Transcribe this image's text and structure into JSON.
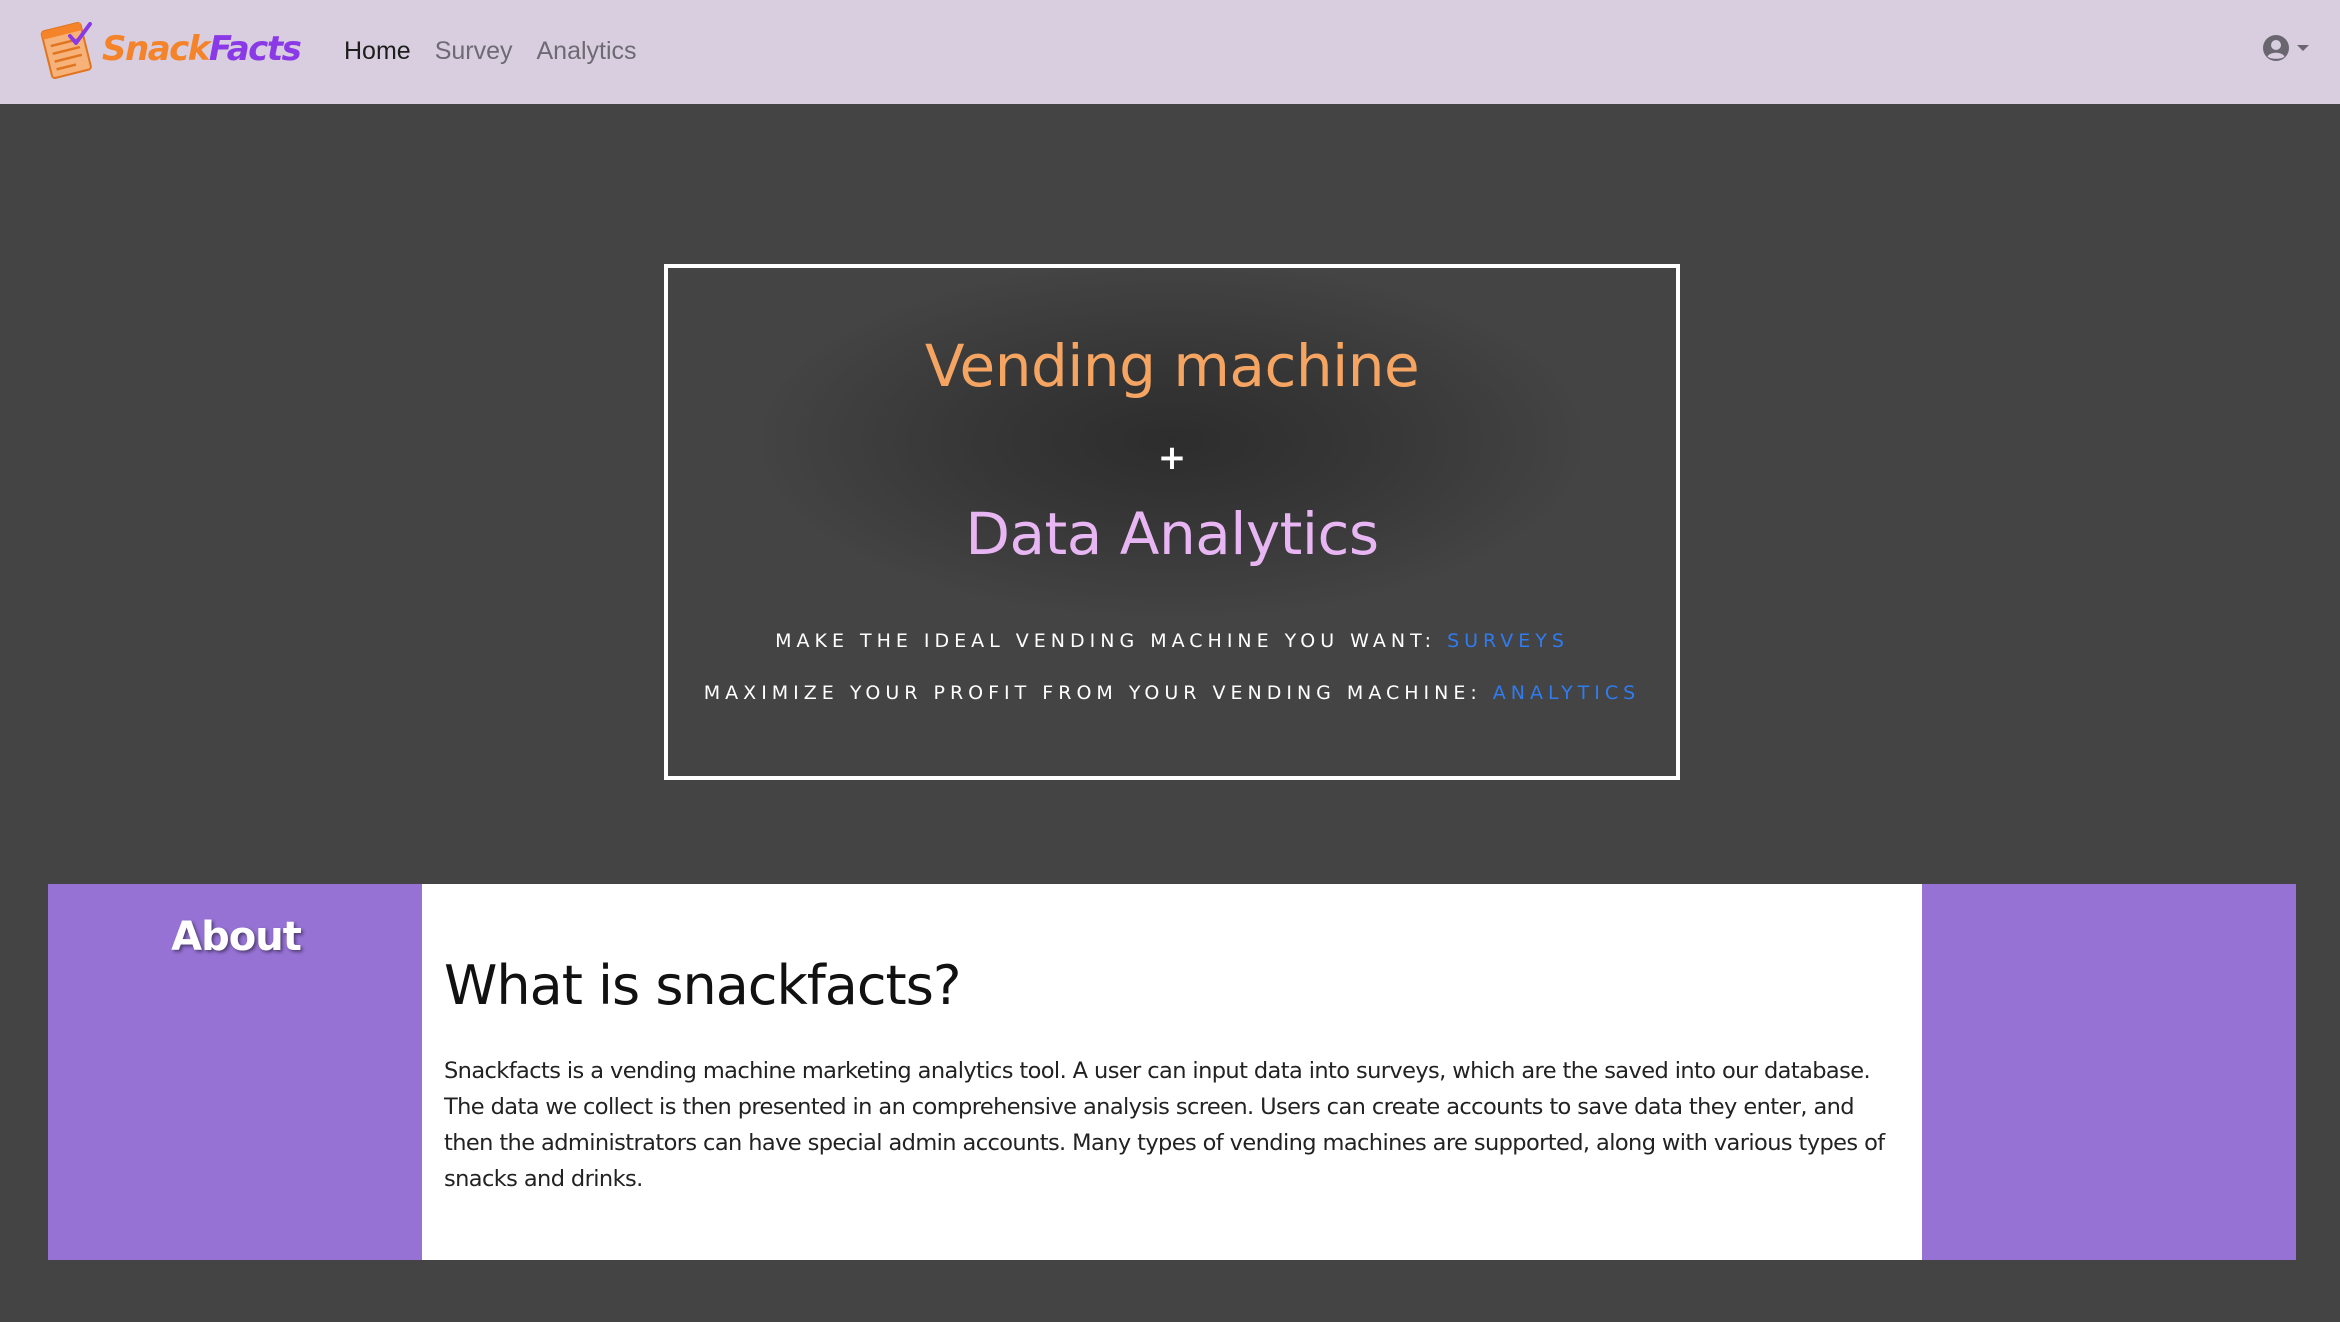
{
  "brand": {
    "name_part1": "Snack",
    "name_part2": "Facts",
    "logo_icon": "notepad-checklist-icon"
  },
  "nav": {
    "links": [
      {
        "label": "Home",
        "active": true
      },
      {
        "label": "Survey",
        "active": false
      },
      {
        "label": "Analytics",
        "active": false
      }
    ],
    "user_icon": "user-circle-icon",
    "dropdown_icon": "caret-down-icon"
  },
  "hero": {
    "title_1": "Vending machine",
    "plus": "+",
    "title_2": "Data Analytics",
    "line_1_text": "MAKE THE IDEAL VENDING MACHINE YOU WANT: ",
    "line_1_link": "SURVEYS",
    "line_2_text": "MAXIMIZE YOUR PROFIT FROM YOUR VENDING MACHINE: ",
    "line_2_link": "ANALYTICS"
  },
  "about": {
    "label": "About",
    "heading": "What is snackfacts?",
    "body": "Snackfacts is a vending machine marketing analytics tool. A user can input data into surveys, which are the saved into our database. The data we collect is then presented in an comprehensive analysis screen. Users can create accounts to save data they enter, and then the administrators can have special admin accounts. Many types of vending machines are supported, along with various types of snacks and drinks."
  },
  "colors": {
    "navbar_bg": "#d8cedf",
    "page_bg": "#444444",
    "brand_orange": "#f4832a",
    "brand_purple": "#8a39e6",
    "hero_title_orange": "#f5a561",
    "hero_title_lavender": "#e7b6f3",
    "link_blue": "#2f7bf0",
    "about_purple": "#9572d4"
  }
}
